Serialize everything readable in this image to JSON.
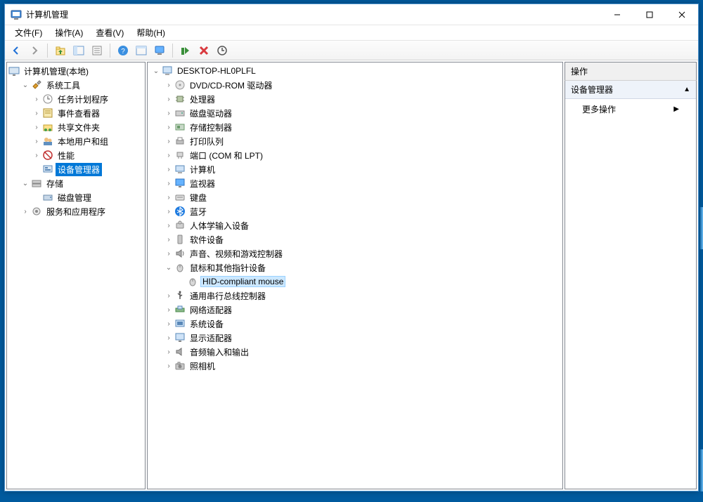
{
  "window": {
    "title": "计算机管理"
  },
  "menus": {
    "file": "文件(F)",
    "action": "操作(A)",
    "view": "查看(V)",
    "help": "帮助(H)"
  },
  "left_tree": {
    "root": "计算机管理(本地)",
    "system_tools": "系统工具",
    "task_scheduler": "任务计划程序",
    "event_viewer": "事件查看器",
    "shared_folders": "共享文件夹",
    "local_users": "本地用户和组",
    "performance": "性能",
    "device_manager": "设备管理器",
    "storage": "存储",
    "disk_mgmt": "磁盘管理",
    "services_apps": "服务和应用程序"
  },
  "center_tree": {
    "root": "DESKTOP-HL0PLFL",
    "dvd": "DVD/CD-ROM 驱动器",
    "cpu": "处理器",
    "disk_drives": "磁盘驱动器",
    "storage_ctrl": "存储控制器",
    "print_queues": "打印队列",
    "ports": "端口 (COM 和 LPT)",
    "computer": "计算机",
    "monitors": "监视器",
    "keyboards": "键盘",
    "bluetooth": "蓝牙",
    "hid": "人体学输入设备",
    "software_dev": "软件设备",
    "sound": "声音、视频和游戏控制器",
    "mice": "鼠标和其他指针设备",
    "hid_mouse": "HID-compliant mouse",
    "usb": "通用串行总线控制器",
    "network": "网络适配器",
    "system_dev": "系统设备",
    "display": "显示适配器",
    "audio_io": "音频输入和输出",
    "camera": "照相机"
  },
  "right_panel": {
    "header": "操作",
    "section": "设备管理器",
    "more_actions": "更多操作"
  }
}
